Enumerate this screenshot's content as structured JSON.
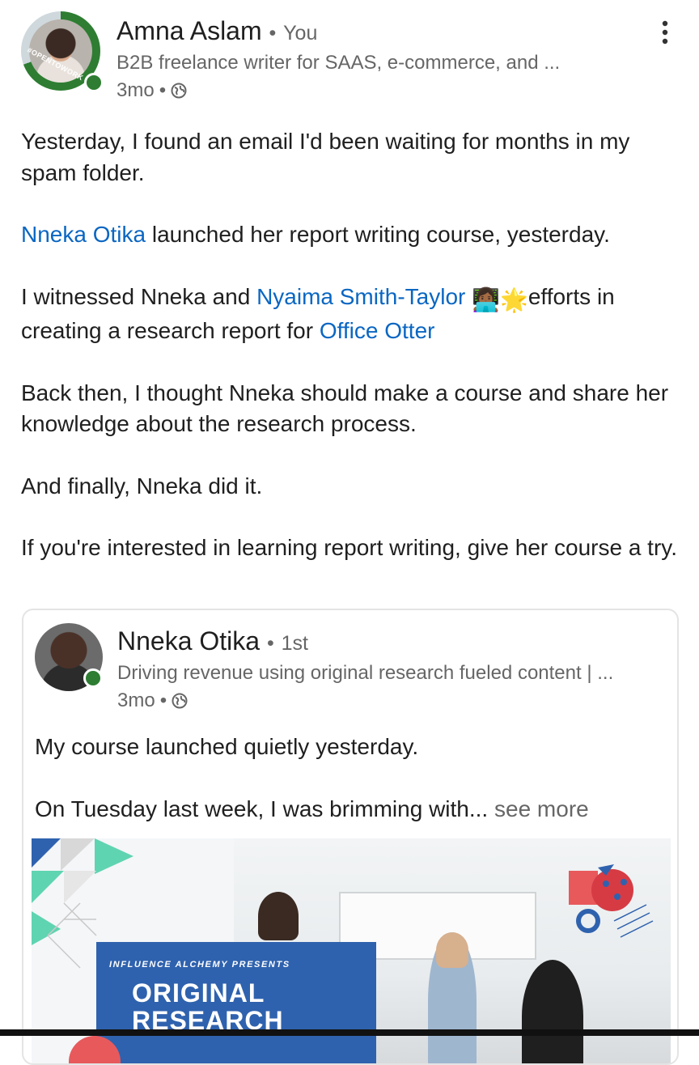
{
  "author": {
    "name": "Amna Aslam",
    "separator": "•",
    "relation": "You",
    "headline": "B2B freelance writer for SAAS, e-commerce, and ...",
    "time": "3mo",
    "meta_sep": "•",
    "frame_text": "#OPENTOWORK",
    "globe_icon": "globe-icon",
    "more_icon": "more-vertical-icon"
  },
  "post": {
    "p1": "Yesterday, I found an email I'd been waiting for months in my spam folder.",
    "p2_link": "Nneka Otika",
    "p2_rest": " launched her report writing course, yesterday.",
    "p3_start": "I witnessed Nneka and ",
    "p3_link1": "Nyaima Smith-Taylor",
    "p3_emoji": "👩🏾‍💻🌟",
    "p3_mid": "efforts in creating a research report for ",
    "p3_link2": "Office Otter",
    "p4": "Back then, I thought Nneka should make a course and share her knowledge about the research process.",
    "p5": "And finally, Nneka did it.",
    "p6": "If you're interested in learning report writing, give her course a try."
  },
  "shared": {
    "name": "Nneka Otika",
    "separator": "•",
    "degree": "1st",
    "headline": "Driving revenue using original research fueled content | ...",
    "time": "3mo",
    "meta_sep": "•",
    "body1": "My course launched quietly yesterday.",
    "body2": "On Tuesday last week, I was brimming with...",
    "see_more": " see more",
    "banner_kicker": "INFLUENCE ALCHEMY PRESENTS",
    "banner_title_1": "ORIGINAL",
    "banner_title_2": "RESEARCH"
  },
  "colors": {
    "link": "#0a66c2",
    "presence": "#2e7d32",
    "banner": "#2f62ae",
    "teal": "#5fd4b0",
    "coral": "#e8595c"
  }
}
